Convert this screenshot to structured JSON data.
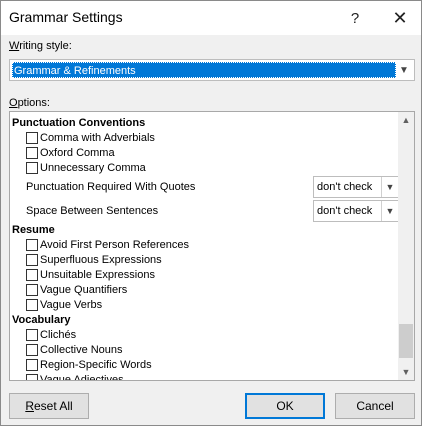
{
  "window": {
    "title": "Grammar Settings",
    "help_glyph": "?",
    "close_glyph": "✕"
  },
  "writing_style": {
    "label": "Writing style:",
    "label_underline": "W",
    "label_rest": "riting style:",
    "selected": "Grammar & Refinements"
  },
  "options": {
    "label_underline": "O",
    "label_rest": "ptions:"
  },
  "list": {
    "punctuation_header": "Punctuation Conventions",
    "comma_adverbials": "Comma with Adverbials",
    "oxford_comma": "Oxford Comma",
    "unnecessary_comma": "Unnecessary Comma",
    "punct_quotes_label": "Punctuation Required With Quotes",
    "punct_quotes_value": "don't check",
    "space_sentences_label": "Space Between Sentences",
    "space_sentences_value": "don't check",
    "resume_header": "Resume",
    "first_person": "Avoid First Person References",
    "superfluous": "Superfluous Expressions",
    "unsuitable": "Unsuitable Expressions",
    "vague_quantifiers": "Vague Quantifiers",
    "vague_verbs": "Vague Verbs",
    "vocabulary_header": "Vocabulary",
    "cliches": "Clichés",
    "collective_nouns": "Collective Nouns",
    "region_specific": "Region-Specific Words",
    "vague_adjectives": "Vague Adjectives"
  },
  "buttons": {
    "reset_all_underline": "R",
    "reset_all_rest": "eset All",
    "ok": "OK",
    "cancel": "Cancel"
  }
}
